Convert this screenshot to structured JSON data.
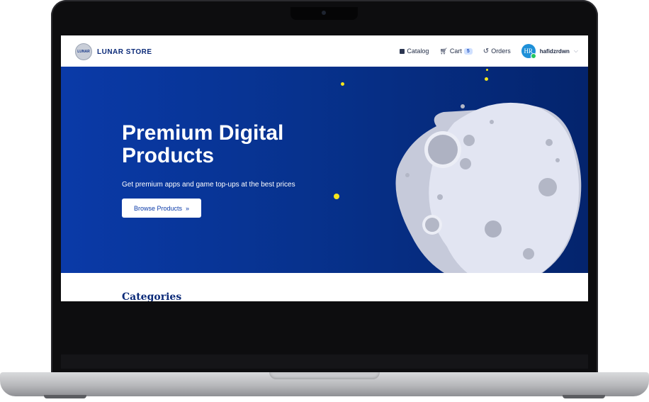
{
  "brand": {
    "name": "LUNAR STORE",
    "logo_text": "LUNAR"
  },
  "nav": {
    "catalog": "Catalog",
    "cart": "Cart",
    "cart_count": "5",
    "orders": "Orders",
    "user_initials": "HR",
    "username": "hafidzrdwn"
  },
  "hero": {
    "title": "Premium Digital Products",
    "subtitle": "Get premium apps and game top-ups at the best prices",
    "cta": "Browse Products",
    "cta_icon": "»"
  },
  "categories": {
    "heading": "Categories"
  },
  "colors": {
    "hero_blue": "#07328e",
    "brand_navy": "#0b2a78",
    "star_yellow": "#f5e61c",
    "moon": "#dfe2f0"
  },
  "icons": [
    "catalog-icon",
    "cart-icon",
    "history-icon",
    "chevron-down-icon",
    "double-chevron-right-icon"
  ]
}
